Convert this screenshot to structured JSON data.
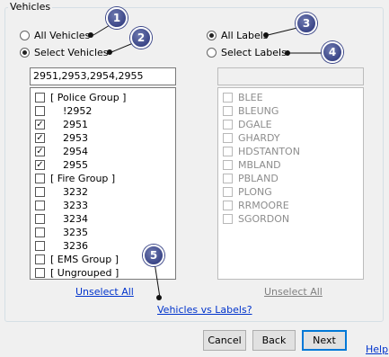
{
  "vehicles_group": {
    "title": "Vehicles",
    "radio_all": {
      "label": "All Vehicles",
      "selected": false
    },
    "radio_select": {
      "label": "Select Vehicles",
      "selected": true
    },
    "filter_value": "2951,2953,2954,2955",
    "items": [
      {
        "label": "[ Police Group ]",
        "checked": false,
        "indent": false
      },
      {
        "label": "!2952",
        "checked": false,
        "indent": true
      },
      {
        "label": "2951",
        "checked": true,
        "indent": true
      },
      {
        "label": "2953",
        "checked": true,
        "indent": true
      },
      {
        "label": "2954",
        "checked": true,
        "indent": true
      },
      {
        "label": "2955",
        "checked": true,
        "indent": true
      },
      {
        "label": "[ Fire Group ]",
        "checked": false,
        "indent": false
      },
      {
        "label": "3232",
        "checked": false,
        "indent": true
      },
      {
        "label": "3233",
        "checked": false,
        "indent": true
      },
      {
        "label": "3234",
        "checked": false,
        "indent": true
      },
      {
        "label": "3235",
        "checked": false,
        "indent": true
      },
      {
        "label": "3236",
        "checked": false,
        "indent": true
      },
      {
        "label": "[ EMS Group ]",
        "checked": false,
        "indent": false
      },
      {
        "label": "[ Ungrouped ]",
        "checked": false,
        "indent": false
      }
    ],
    "unselect_all": "Unselect All"
  },
  "labels_group": {
    "radio_all": {
      "label": "All Labels",
      "selected": true
    },
    "radio_select": {
      "label": "Select Labels",
      "selected": false
    },
    "filter_value": "",
    "items": [
      {
        "label": "BLEE",
        "checked": false
      },
      {
        "label": "BLEUNG",
        "checked": false
      },
      {
        "label": "DGALE",
        "checked": false
      },
      {
        "label": "GHARDY",
        "checked": false
      },
      {
        "label": "HDSTANTON",
        "checked": false
      },
      {
        "label": "MBLAND",
        "checked": false
      },
      {
        "label": "PBLAND",
        "checked": false
      },
      {
        "label": "PLONG",
        "checked": false
      },
      {
        "label": "RRMOORE",
        "checked": false
      },
      {
        "label": "SGORDON",
        "checked": false
      }
    ],
    "unselect_all": "Unselect All"
  },
  "vehicles_vs_labels_link": "Vehicles vs Labels?",
  "buttons": {
    "cancel": "Cancel",
    "back": "Back",
    "next": "Next"
  },
  "help_link": "Help",
  "callouts": [
    "1",
    "2",
    "3",
    "4",
    "5"
  ],
  "colors": {
    "link": "#0033cc",
    "callout": "#3b4688",
    "default_button_border": "#0078d7"
  }
}
